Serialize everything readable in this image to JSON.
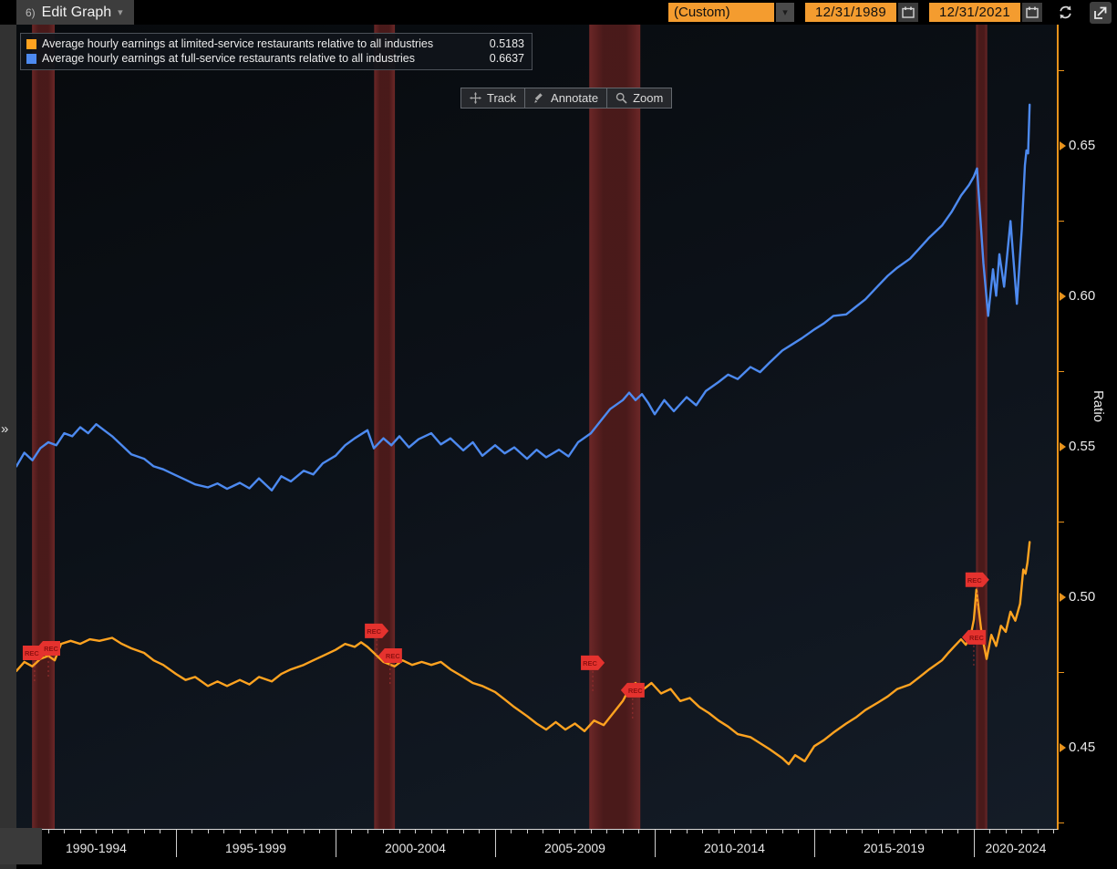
{
  "top_bar": {
    "edit_graph_number": "6)",
    "edit_graph_label": "Edit Graph",
    "caret": "▾",
    "range_preset": "(Custom)",
    "date_start": "12/31/1989",
    "date_end": "12/31/2021"
  },
  "side": {
    "collapse_chevron": "»"
  },
  "legend": {
    "items": [
      {
        "label": "Average hourly earnings at limited-service restaurants relative to all industries",
        "value": "0.5183",
        "color": "#ffa320"
      },
      {
        "label": "Average hourly earnings at full-service restaurants relative to all industries",
        "value": "0.6637",
        "color": "#4d8af0"
      }
    ]
  },
  "toolbar": {
    "items": [
      {
        "icon": "track-icon",
        "label": "Track"
      },
      {
        "icon": "annotate-icon",
        "label": "Annotate"
      },
      {
        "icon": "zoom-icon",
        "label": "Zoom"
      }
    ]
  },
  "y_axis": {
    "title": "Ratio",
    "major": [
      {
        "label": "0.65",
        "value": 0.65
      },
      {
        "label": "0.60",
        "value": 0.6
      },
      {
        "label": "0.55",
        "value": 0.55
      },
      {
        "label": "0.50",
        "value": 0.5
      },
      {
        "label": "0.45",
        "value": 0.45
      }
    ],
    "minor_values": [
      0.675,
      0.625,
      0.575,
      0.525,
      0.475,
      0.425
    ],
    "axis_color": "#e8931c"
  },
  "x_axis": {
    "bin_labels": [
      "1990-1994",
      "1995-1999",
      "2000-2004",
      "2005-2009",
      "2010-2014",
      "2015-2019",
      "2020-2024"
    ],
    "boundaries": [
      1990,
      1995,
      2000,
      2005,
      2010,
      2015,
      2020
    ],
    "tick_step_years": 0.5
  },
  "chart_data": {
    "type": "line",
    "title": "Average hourly earnings at restaurants relative to all industries",
    "xlabel": "",
    "ylabel": "Ratio",
    "x_range": [
      1990,
      2022.63
    ],
    "y_range": [
      0.4227,
      0.6903
    ],
    "grid": false,
    "legend_position": "top-left",
    "recessions": [
      [
        1990.49,
        1991.2
      ],
      [
        2001.21,
        2001.86
      ],
      [
        2007.95,
        2009.55
      ],
      [
        2020.07,
        2020.42
      ]
    ],
    "rec_markers": [
      {
        "t": 1990.57,
        "v": 0.4815,
        "dir": "right",
        "label": "REC"
      },
      {
        "t": 1991.0,
        "v": 0.483,
        "dir": "left",
        "label": "REC"
      },
      {
        "t": 2001.29,
        "v": 0.4888,
        "dir": "right",
        "label": "REC"
      },
      {
        "t": 2001.71,
        "v": 0.4806,
        "dir": "left",
        "label": "REC"
      },
      {
        "t": 2008.06,
        "v": 0.4782,
        "dir": "right",
        "label": "REC"
      },
      {
        "t": 2009.31,
        "v": 0.4691,
        "dir": "left",
        "label": "REC"
      },
      {
        "t": 2020.11,
        "v": 0.5058,
        "dir": "right",
        "label": "REC"
      },
      {
        "t": 2020.0,
        "v": 0.4867,
        "dir": "left",
        "label": "REC"
      }
    ],
    "series": [
      {
        "name": "Average hourly earnings at limited-service restaurants relative to all industries",
        "color": "#ffa320",
        "last_value": 0.5183,
        "points": [
          [
            1990.0,
            0.4755
          ],
          [
            1990.25,
            0.4785
          ],
          [
            1990.5,
            0.477
          ],
          [
            1990.75,
            0.4795
          ],
          [
            1991.0,
            0.4805
          ],
          [
            1991.2,
            0.479
          ],
          [
            1991.4,
            0.4845
          ],
          [
            1991.7,
            0.4855
          ],
          [
            1992.0,
            0.4845
          ],
          [
            1992.3,
            0.486
          ],
          [
            1992.6,
            0.4855
          ],
          [
            1993.0,
            0.4865
          ],
          [
            1993.3,
            0.4845
          ],
          [
            1993.6,
            0.483
          ],
          [
            1994.0,
            0.4815
          ],
          [
            1994.3,
            0.479
          ],
          [
            1994.6,
            0.4775
          ],
          [
            1995.0,
            0.4745
          ],
          [
            1995.3,
            0.4725
          ],
          [
            1995.6,
            0.4735
          ],
          [
            1996.0,
            0.4705
          ],
          [
            1996.3,
            0.472
          ],
          [
            1996.6,
            0.4705
          ],
          [
            1997.0,
            0.4725
          ],
          [
            1997.3,
            0.471
          ],
          [
            1997.6,
            0.4735
          ],
          [
            1998.0,
            0.472
          ],
          [
            1998.3,
            0.4745
          ],
          [
            1998.6,
            0.476
          ],
          [
            1999.0,
            0.4775
          ],
          [
            1999.3,
            0.479
          ],
          [
            1999.6,
            0.4805
          ],
          [
            2000.0,
            0.4825
          ],
          [
            2000.3,
            0.4845
          ],
          [
            2000.6,
            0.4835
          ],
          [
            2000.8,
            0.485
          ],
          [
            2001.0,
            0.4835
          ],
          [
            2001.2,
            0.4815
          ],
          [
            2001.5,
            0.4785
          ],
          [
            2001.85,
            0.477
          ],
          [
            2002.1,
            0.479
          ],
          [
            2002.4,
            0.4775
          ],
          [
            2002.7,
            0.4785
          ],
          [
            2003.0,
            0.4775
          ],
          [
            2003.3,
            0.4785
          ],
          [
            2003.6,
            0.476
          ],
          [
            2004.0,
            0.4735
          ],
          [
            2004.3,
            0.4715
          ],
          [
            2004.6,
            0.4705
          ],
          [
            2005.0,
            0.4685
          ],
          [
            2005.3,
            0.466
          ],
          [
            2005.6,
            0.4635
          ],
          [
            2006.0,
            0.4605
          ],
          [
            2006.3,
            0.458
          ],
          [
            2006.6,
            0.456
          ],
          [
            2006.9,
            0.4585
          ],
          [
            2007.2,
            0.456
          ],
          [
            2007.5,
            0.458
          ],
          [
            2007.8,
            0.4555
          ],
          [
            2008.1,
            0.459
          ],
          [
            2008.4,
            0.4575
          ],
          [
            2008.7,
            0.4615
          ],
          [
            2009.0,
            0.4655
          ],
          [
            2009.2,
            0.4695
          ],
          [
            2009.4,
            0.4715
          ],
          [
            2009.6,
            0.469
          ],
          [
            2009.9,
            0.4715
          ],
          [
            2010.2,
            0.468
          ],
          [
            2010.5,
            0.4695
          ],
          [
            2010.8,
            0.4655
          ],
          [
            2011.1,
            0.4665
          ],
          [
            2011.4,
            0.4635
          ],
          [
            2011.7,
            0.4615
          ],
          [
            2012.0,
            0.459
          ],
          [
            2012.3,
            0.457
          ],
          [
            2012.6,
            0.4545
          ],
          [
            2013.0,
            0.4535
          ],
          [
            2013.3,
            0.4515
          ],
          [
            2013.6,
            0.4495
          ],
          [
            2014.0,
            0.4465
          ],
          [
            2014.2,
            0.4445
          ],
          [
            2014.4,
            0.4475
          ],
          [
            2014.7,
            0.4455
          ],
          [
            2015.0,
            0.4505
          ],
          [
            2015.3,
            0.4525
          ],
          [
            2015.6,
            0.455
          ],
          [
            2016.0,
            0.458
          ],
          [
            2016.3,
            0.46
          ],
          [
            2016.6,
            0.4625
          ],
          [
            2017.0,
            0.465
          ],
          [
            2017.3,
            0.467
          ],
          [
            2017.6,
            0.4695
          ],
          [
            2018.0,
            0.471
          ],
          [
            2018.3,
            0.4735
          ],
          [
            2018.6,
            0.476
          ],
          [
            2019.0,
            0.479
          ],
          [
            2019.2,
            0.4815
          ],
          [
            2019.4,
            0.4838
          ],
          [
            2019.6,
            0.486
          ],
          [
            2019.75,
            0.4842
          ],
          [
            2019.9,
            0.4872
          ],
          [
            2020.0,
            0.4925
          ],
          [
            2020.08,
            0.5025
          ],
          [
            2020.25,
            0.4875
          ],
          [
            2020.4,
            0.4795
          ],
          [
            2020.55,
            0.4875
          ],
          [
            2020.7,
            0.4838
          ],
          [
            2020.85,
            0.4905
          ],
          [
            2021.0,
            0.4885
          ],
          [
            2021.15,
            0.4952
          ],
          [
            2021.3,
            0.4922
          ],
          [
            2021.45,
            0.4978
          ],
          [
            2021.55,
            0.5092
          ],
          [
            2021.62,
            0.5078
          ],
          [
            2021.68,
            0.5115
          ],
          [
            2021.75,
            0.5183
          ]
        ]
      },
      {
        "name": "Average hourly earnings at full-service restaurants relative to all industries",
        "color": "#4d8af0",
        "last_value": 0.6637,
        "points": [
          [
            1990.0,
            0.5435
          ],
          [
            1990.25,
            0.548
          ],
          [
            1990.5,
            0.5455
          ],
          [
            1990.75,
            0.5495
          ],
          [
            1991.0,
            0.5515
          ],
          [
            1991.25,
            0.5505
          ],
          [
            1991.5,
            0.5545
          ],
          [
            1991.75,
            0.5535
          ],
          [
            1992.0,
            0.5565
          ],
          [
            1992.25,
            0.5545
          ],
          [
            1992.5,
            0.5575
          ],
          [
            1992.75,
            0.5555
          ],
          [
            1993.0,
            0.5535
          ],
          [
            1993.3,
            0.5505
          ],
          [
            1993.6,
            0.5475
          ],
          [
            1994.0,
            0.546
          ],
          [
            1994.3,
            0.5435
          ],
          [
            1994.6,
            0.5425
          ],
          [
            1995.0,
            0.5405
          ],
          [
            1995.3,
            0.539
          ],
          [
            1995.6,
            0.5375
          ],
          [
            1996.0,
            0.5365
          ],
          [
            1996.3,
            0.5378
          ],
          [
            1996.6,
            0.536
          ],
          [
            1997.0,
            0.538
          ],
          [
            1997.3,
            0.5362
          ],
          [
            1997.6,
            0.5395
          ],
          [
            1998.0,
            0.5355
          ],
          [
            1998.3,
            0.5402
          ],
          [
            1998.6,
            0.5385
          ],
          [
            1999.0,
            0.542
          ],
          [
            1999.3,
            0.5408
          ],
          [
            1999.6,
            0.5445
          ],
          [
            2000.0,
            0.547
          ],
          [
            2000.3,
            0.5505
          ],
          [
            2000.6,
            0.5528
          ],
          [
            2001.0,
            0.5555
          ],
          [
            2001.2,
            0.5495
          ],
          [
            2001.5,
            0.5528
          ],
          [
            2001.75,
            0.5505
          ],
          [
            2002.0,
            0.5535
          ],
          [
            2002.3,
            0.5498
          ],
          [
            2002.6,
            0.5525
          ],
          [
            2003.0,
            0.5545
          ],
          [
            2003.3,
            0.5508
          ],
          [
            2003.6,
            0.5528
          ],
          [
            2004.0,
            0.5488
          ],
          [
            2004.3,
            0.5515
          ],
          [
            2004.6,
            0.547
          ],
          [
            2005.0,
            0.5505
          ],
          [
            2005.3,
            0.5478
          ],
          [
            2005.6,
            0.5498
          ],
          [
            2006.0,
            0.546
          ],
          [
            2006.3,
            0.549
          ],
          [
            2006.6,
            0.5465
          ],
          [
            2007.0,
            0.549
          ],
          [
            2007.3,
            0.5468
          ],
          [
            2007.6,
            0.5515
          ],
          [
            2008.0,
            0.5545
          ],
          [
            2008.3,
            0.5585
          ],
          [
            2008.6,
            0.5625
          ],
          [
            2009.0,
            0.5655
          ],
          [
            2009.2,
            0.568
          ],
          [
            2009.4,
            0.5655
          ],
          [
            2009.6,
            0.5675
          ],
          [
            2009.8,
            0.5645
          ],
          [
            2010.0,
            0.5608
          ],
          [
            2010.3,
            0.5655
          ],
          [
            2010.6,
            0.5618
          ],
          [
            2011.0,
            0.5665
          ],
          [
            2011.3,
            0.5638
          ],
          [
            2011.6,
            0.5685
          ],
          [
            2012.0,
            0.5715
          ],
          [
            2012.3,
            0.574
          ],
          [
            2012.6,
            0.5725
          ],
          [
            2013.0,
            0.5765
          ],
          [
            2013.3,
            0.5748
          ],
          [
            2013.6,
            0.578
          ],
          [
            2014.0,
            0.582
          ],
          [
            2014.3,
            0.584
          ],
          [
            2014.6,
            0.586
          ],
          [
            2015.0,
            0.589
          ],
          [
            2015.3,
            0.591
          ],
          [
            2015.6,
            0.5935
          ],
          [
            2016.0,
            0.594
          ],
          [
            2016.3,
            0.5965
          ],
          [
            2016.6,
            0.599
          ],
          [
            2017.0,
            0.6035
          ],
          [
            2017.3,
            0.6068
          ],
          [
            2017.6,
            0.6095
          ],
          [
            2018.0,
            0.6125
          ],
          [
            2018.3,
            0.616
          ],
          [
            2018.6,
            0.6195
          ],
          [
            2019.0,
            0.6235
          ],
          [
            2019.3,
            0.628
          ],
          [
            2019.6,
            0.6335
          ],
          [
            2019.85,
            0.637
          ],
          [
            2020.0,
            0.6398
          ],
          [
            2020.1,
            0.6425
          ],
          [
            2020.3,
            0.611
          ],
          [
            2020.45,
            0.5935
          ],
          [
            2020.6,
            0.609
          ],
          [
            2020.7,
            0.6002
          ],
          [
            2020.8,
            0.614
          ],
          [
            2020.95,
            0.6032
          ],
          [
            2021.15,
            0.625
          ],
          [
            2021.35,
            0.5975
          ],
          [
            2021.5,
            0.622
          ],
          [
            2021.6,
            0.6435
          ],
          [
            2021.65,
            0.6485
          ],
          [
            2021.7,
            0.6475
          ],
          [
            2021.75,
            0.6637
          ]
        ]
      }
    ]
  },
  "colors": {
    "accent_orange": "#f49c2f",
    "axis_orange": "#e8931c",
    "recession_fill": "#4c1a1a",
    "recession_edge": "#702828",
    "rec_marker_red": "#e5322e",
    "rec_marker_text": "#8f1111"
  }
}
